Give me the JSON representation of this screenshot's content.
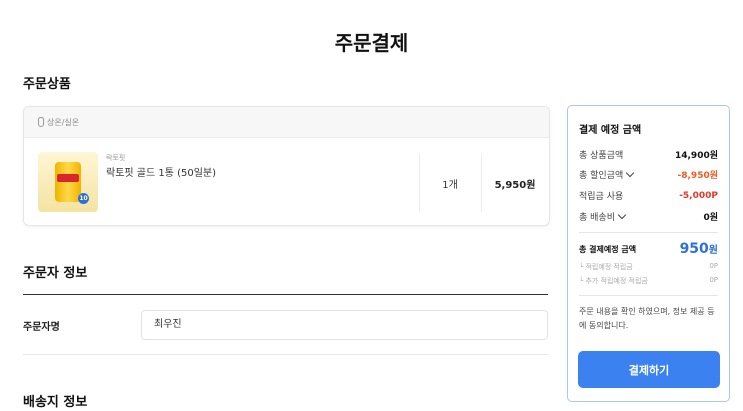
{
  "page_title": "주문결제",
  "sections": {
    "order_products": "주문상품",
    "orderer_info": "주문자 정보",
    "shipping_info": "배송지 정보"
  },
  "product_card": {
    "storage_type": "상온/실온",
    "brand": "락토핏",
    "name": "락토핏 골드 1통 (50일분)",
    "quantity": "1개",
    "price": "5,950원"
  },
  "orderer": {
    "label": "주문자명",
    "value": "최우진"
  },
  "summary": {
    "title": "결제 예정 금액",
    "lines": [
      {
        "label": "총 상품금액",
        "value": "14,900원"
      },
      {
        "label": "총 할인금액",
        "value": "-8,950원"
      },
      {
        "label": "적립금 사용",
        "value": "-5,000P"
      },
      {
        "label": "총 배송비",
        "value": "0원"
      }
    ],
    "total_label": "총 결제예정 금액",
    "total_value": "950",
    "total_unit": "원",
    "sub_lines": [
      {
        "label": "└ 적립예정 적립금",
        "value": "0P"
      },
      {
        "label": "└ 추가 적립예정 적립금",
        "value": "0P"
      }
    ],
    "agreement": "주문 내용을 확인 하였으며, 정보 제공 등에 동의합니다.",
    "pay_button": "결제하기"
  },
  "colors": {
    "accent": "#3b82f0",
    "discount": "#ef5b22",
    "points": "#e5382b",
    "summary_border": "#a8c8ee"
  }
}
